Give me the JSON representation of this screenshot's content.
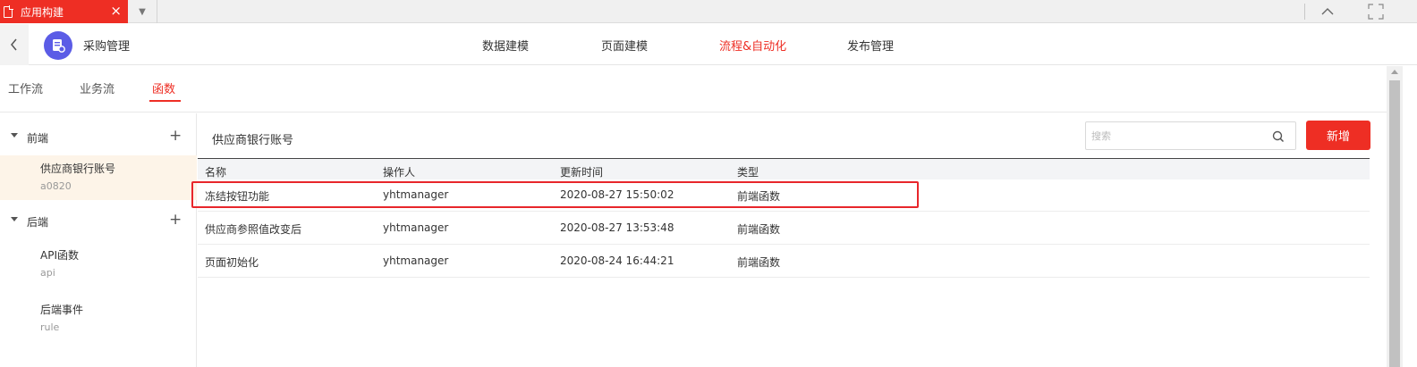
{
  "tabbar": {
    "tab_label": "应用构建",
    "close_glyph": "×",
    "dropdown_glyph": "▼"
  },
  "header": {
    "app_name": "采购管理",
    "nav": [
      {
        "label": "数据建模",
        "active": false
      },
      {
        "label": "页面建模",
        "active": false
      },
      {
        "label": "流程&自动化",
        "active": true
      },
      {
        "label": "发布管理",
        "active": false
      }
    ],
    "accent_color": "#ee2e24",
    "logo_color": "#5b5ce6"
  },
  "subtabs": [
    {
      "label": "工作流",
      "active": false
    },
    {
      "label": "业务流",
      "active": false
    },
    {
      "label": "函数",
      "active": true
    }
  ],
  "sidebar": {
    "groups": [
      {
        "label": "前端",
        "items": [
          {
            "label": "供应商银行账号",
            "sub": "a0820",
            "selected": true
          }
        ]
      },
      {
        "label": "后端",
        "items": [
          {
            "label": "API函数",
            "sub": "api",
            "selected": false
          },
          {
            "label": "后端事件",
            "sub": "rule",
            "selected": false
          }
        ]
      }
    ],
    "plus_glyph": "+"
  },
  "main": {
    "title": "供应商银行账号",
    "search_placeholder": "搜索",
    "add_button": "新增",
    "columns": [
      "名称",
      "操作人",
      "更新时间",
      "类型"
    ],
    "rows": [
      {
        "name": "冻结按钮功能",
        "operator": "yhtmanager",
        "updated": "2020-08-27 15:50:02",
        "type": "前端函数",
        "highlighted": true
      },
      {
        "name": "供应商参照值改变后",
        "operator": "yhtmanager",
        "updated": "2020-08-27 13:53:48",
        "type": "前端函数",
        "highlighted": false
      },
      {
        "name": "页面初始化",
        "operator": "yhtmanager",
        "updated": "2020-08-24 16:44:21",
        "type": "前端函数",
        "highlighted": false
      }
    ]
  }
}
